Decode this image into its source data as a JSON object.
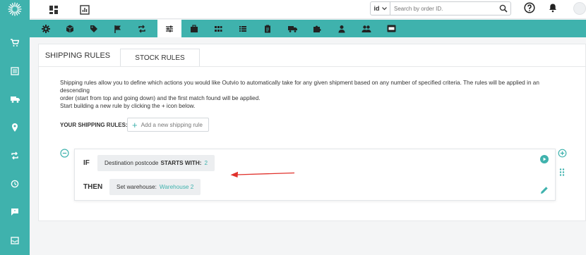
{
  "search": {
    "type_value": "id",
    "placeholder": "Search by order ID."
  },
  "tabs": {
    "shipping_rules": "SHIPPING RULES",
    "stock_rules": "STOCK RULES"
  },
  "description": {
    "line1": "Shipping rules allow you to define which actions you would like Outvio to automatically take for any given shipment based on any number of specified criteria. The rules will be applied in an descending",
    "line2": "order (start from top and going down) and the first match found will be applied.",
    "line3": "Start building a new rule by clicking the + icon below."
  },
  "rules_label": "YOUR SHIPPING RULES:",
  "add_rule_label": "Add a new shipping rule",
  "rule": {
    "if_keyword": "IF",
    "condition_field": "Destination postcode",
    "condition_operator": "STARTS WITH:",
    "condition_value": "2",
    "then_keyword": "THEN",
    "action_label": "Set warehouse:",
    "action_value": "Warehouse 2"
  },
  "colors": {
    "accent": "#3fb2ad",
    "arrow": "#e0312b"
  },
  "icons": {
    "sidebar": [
      "logo-sunburst-icon",
      "cart-icon",
      "document-list-icon",
      "truck-icon",
      "location-pin-icon",
      "repeat-icon",
      "history-icon",
      "chat-icon",
      "mail-icon"
    ],
    "tabstrip": [
      "gear-icon",
      "box-icon",
      "tag-icon",
      "flag-icon",
      "repeat-icon",
      "sliders-icon",
      "briefcase-icon",
      "grid-icon",
      "list-icon",
      "clipboard-icon",
      "truck-icon",
      "puzzle-icon",
      "person-icon",
      "people-icon",
      "sdl-badge-icon"
    ]
  }
}
